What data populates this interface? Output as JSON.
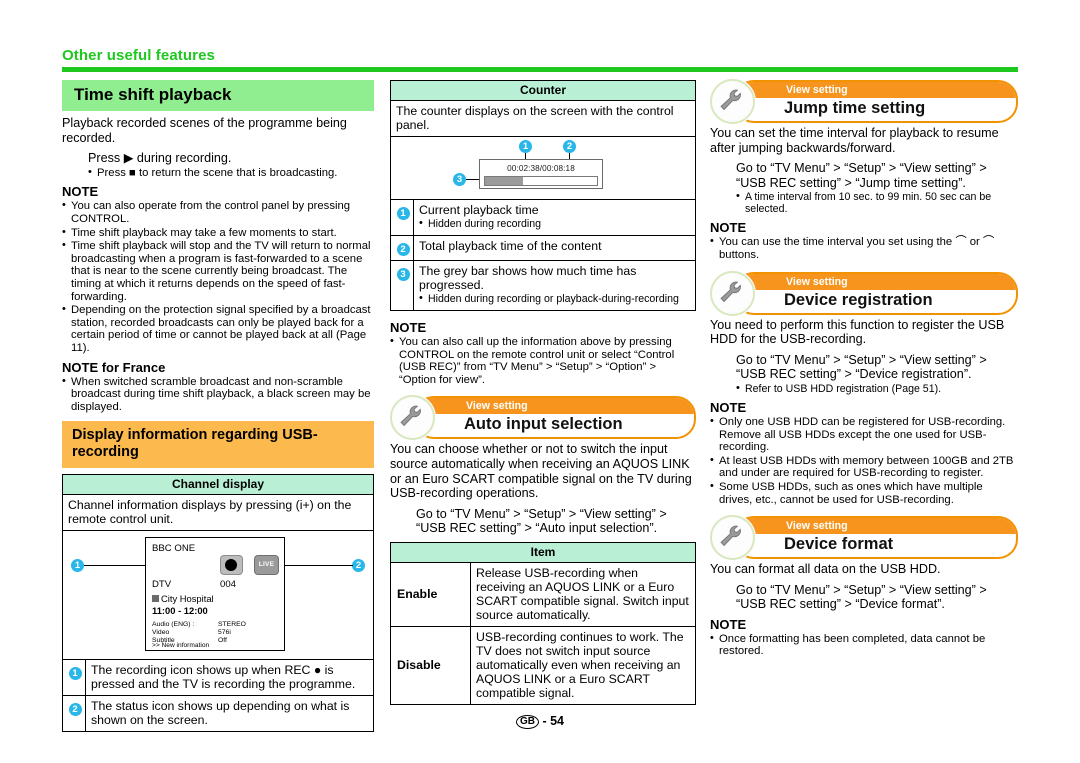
{
  "runhead": {
    "title": "Other useful features"
  },
  "footer": {
    "region": "GB",
    "separator": "-",
    "page": "54"
  },
  "col1": {
    "section_title": "Time shift playback",
    "intro": "Playback recorded scenes of the programme being recorded.",
    "step": "Press ▶ during recording.",
    "step_bullet": "Press ■ to return the scene that is broadcasting.",
    "note_heading": "NOTE",
    "notes": [
      "You can also operate from the control panel by pressing CONTROL.",
      "Time shift playback may take a few moments to start.",
      "Time shift playback will stop and the TV will return to normal broadcasting when a program is fast-forwarded to a scene that is near to the scene currently being broadcast. The timing at which it returns depends on the speed of fast-forwarding.",
      "Depending on the protection signal specified by a broadcast station, recorded broadcasts can only be played back for a certain period of time or cannot be played back at all (Page 11)."
    ],
    "note_france_heading": "NOTE for France",
    "note_france": "When switched scramble broadcast and non-scramble broadcast during time shift playback, a black screen may be displayed.",
    "usb_title": "Display information regarding USB-recording",
    "channel_table": {
      "header": "Channel display",
      "intro": "Channel information displays by pressing (i+) on the remote control unit.",
      "tv": {
        "channel_name": "BBC ONE",
        "rec_icon": "rec-dot-icon",
        "status_icon_label": "LIVE",
        "source": "DTV",
        "channel_number": "004",
        "programme": "City Hospital",
        "time": "11:00 - 12:00",
        "rows": [
          {
            "label": "Audio (ENG) :",
            "value": "STEREO"
          },
          {
            "label": "Video",
            "value": "576i"
          },
          {
            "label": "Subtitle",
            "value": "Off"
          }
        ],
        "more": ">> New information",
        "callout1": "1",
        "callout2": "2"
      },
      "rows": [
        {
          "n": "1",
          "text": "The recording icon shows up when REC ● is pressed and the TV is recording the programme."
        },
        {
          "n": "2",
          "text": "The status icon shows up depending on what is shown on the screen."
        }
      ]
    }
  },
  "col2": {
    "counter_table": {
      "header": "Counter",
      "intro": "The counter displays on the screen with the control panel.",
      "mock": {
        "time": "00:02:38/00:08:18",
        "callout1": "1",
        "callout2": "2",
        "callout3": "3"
      },
      "rows": [
        {
          "n": "1",
          "text": "Current playback time",
          "bullets": [
            "Hidden during recording"
          ]
        },
        {
          "n": "2",
          "text": "Total playback time of the content",
          "bullets": []
        },
        {
          "n": "3",
          "text": "The grey bar shows how much time has progressed.",
          "bullets": [
            "Hidden during recording or playback-during-recording"
          ]
        }
      ]
    },
    "note_heading": "NOTE",
    "note": "You can also call up the information above by pressing CONTROL on the remote control unit or select “Control (USB REC)” from “TV Menu” > “Setup” > “Option” > “Option for view”.",
    "banner": {
      "label": "View setting",
      "title": "Auto input selection",
      "icon": "wrench-icon"
    },
    "body": "You can choose whether or not to switch the input source automatically when receiving an AQUOS LINK or an Euro SCART compatible signal on the TV during USB-recording operations.",
    "path": "Go to “TV Menu” > “Setup” > “View setting” > “USB REC setting” > “Auto input selection”.",
    "item_table": {
      "header": "Item",
      "rows": [
        {
          "label": "Enable",
          "text": "Release USB-recording when receiving an AQUOS LINK or a Euro SCART compatible signal. Switch input source automatically."
        },
        {
          "label": "Disable",
          "text": "USB-recording continues to work. The TV does not switch input source automatically even when receiving an AQUOS LINK or a Euro SCART compatible signal."
        }
      ]
    }
  },
  "col3": {
    "jump": {
      "banner": {
        "label": "View setting",
        "title": "Jump time setting",
        "icon": "wrench-icon"
      },
      "body": "You can set the time interval for playback to resume after jumping backwards/forward.",
      "path": "Go to “TV Menu” > “Setup” > “View setting” > “USB REC setting” > “Jump time setting”.",
      "path_bullet": "A time interval from 10 sec. to 99 min. 50 sec can be selected.",
      "note_heading": "NOTE",
      "note": "You can use the time interval you set using the ⌒ or ⌒ buttons."
    },
    "registration": {
      "banner": {
        "label": "View setting",
        "title": "Device registration",
        "icon": "wrench-icon"
      },
      "body": "You need to perform this function to register the USB HDD for the USB-recording.",
      "path": "Go to “TV Menu” > “Setup” > “View setting” > “USB REC setting” > “Device registration”.",
      "path_bullet": "Refer to USB HDD registration (Page 51).",
      "note_heading": "NOTE",
      "notes": [
        "Only one USB HDD can be registered for USB-recording. Remove all USB HDDs except the one used for USB-recording.",
        "At least USB HDDs with memory between 100GB and 2TB and under are required for USB-recording to register.",
        "Some USB HDDs, such as ones which have multiple drives, etc., cannot be used for USB-recording."
      ]
    },
    "format": {
      "banner": {
        "label": "View setting",
        "title": "Device format",
        "icon": "wrench-icon"
      },
      "body": "You can format all data on the USB HDD.",
      "path": "Go to “TV Menu” > “Setup” > “View setting” > “USB REC setting” > “Device format”.",
      "note_heading": "NOTE",
      "note": "Once formatting has been completed, data cannot be restored."
    }
  },
  "colors": {
    "green_accent": "#1ec81e",
    "green_header": "#90ee90",
    "mint_table_header": "#b9f0d5",
    "orange_header": "#fcb94d",
    "orange_banner": "#f7941d",
    "callout_blue": "#29b6e8"
  }
}
